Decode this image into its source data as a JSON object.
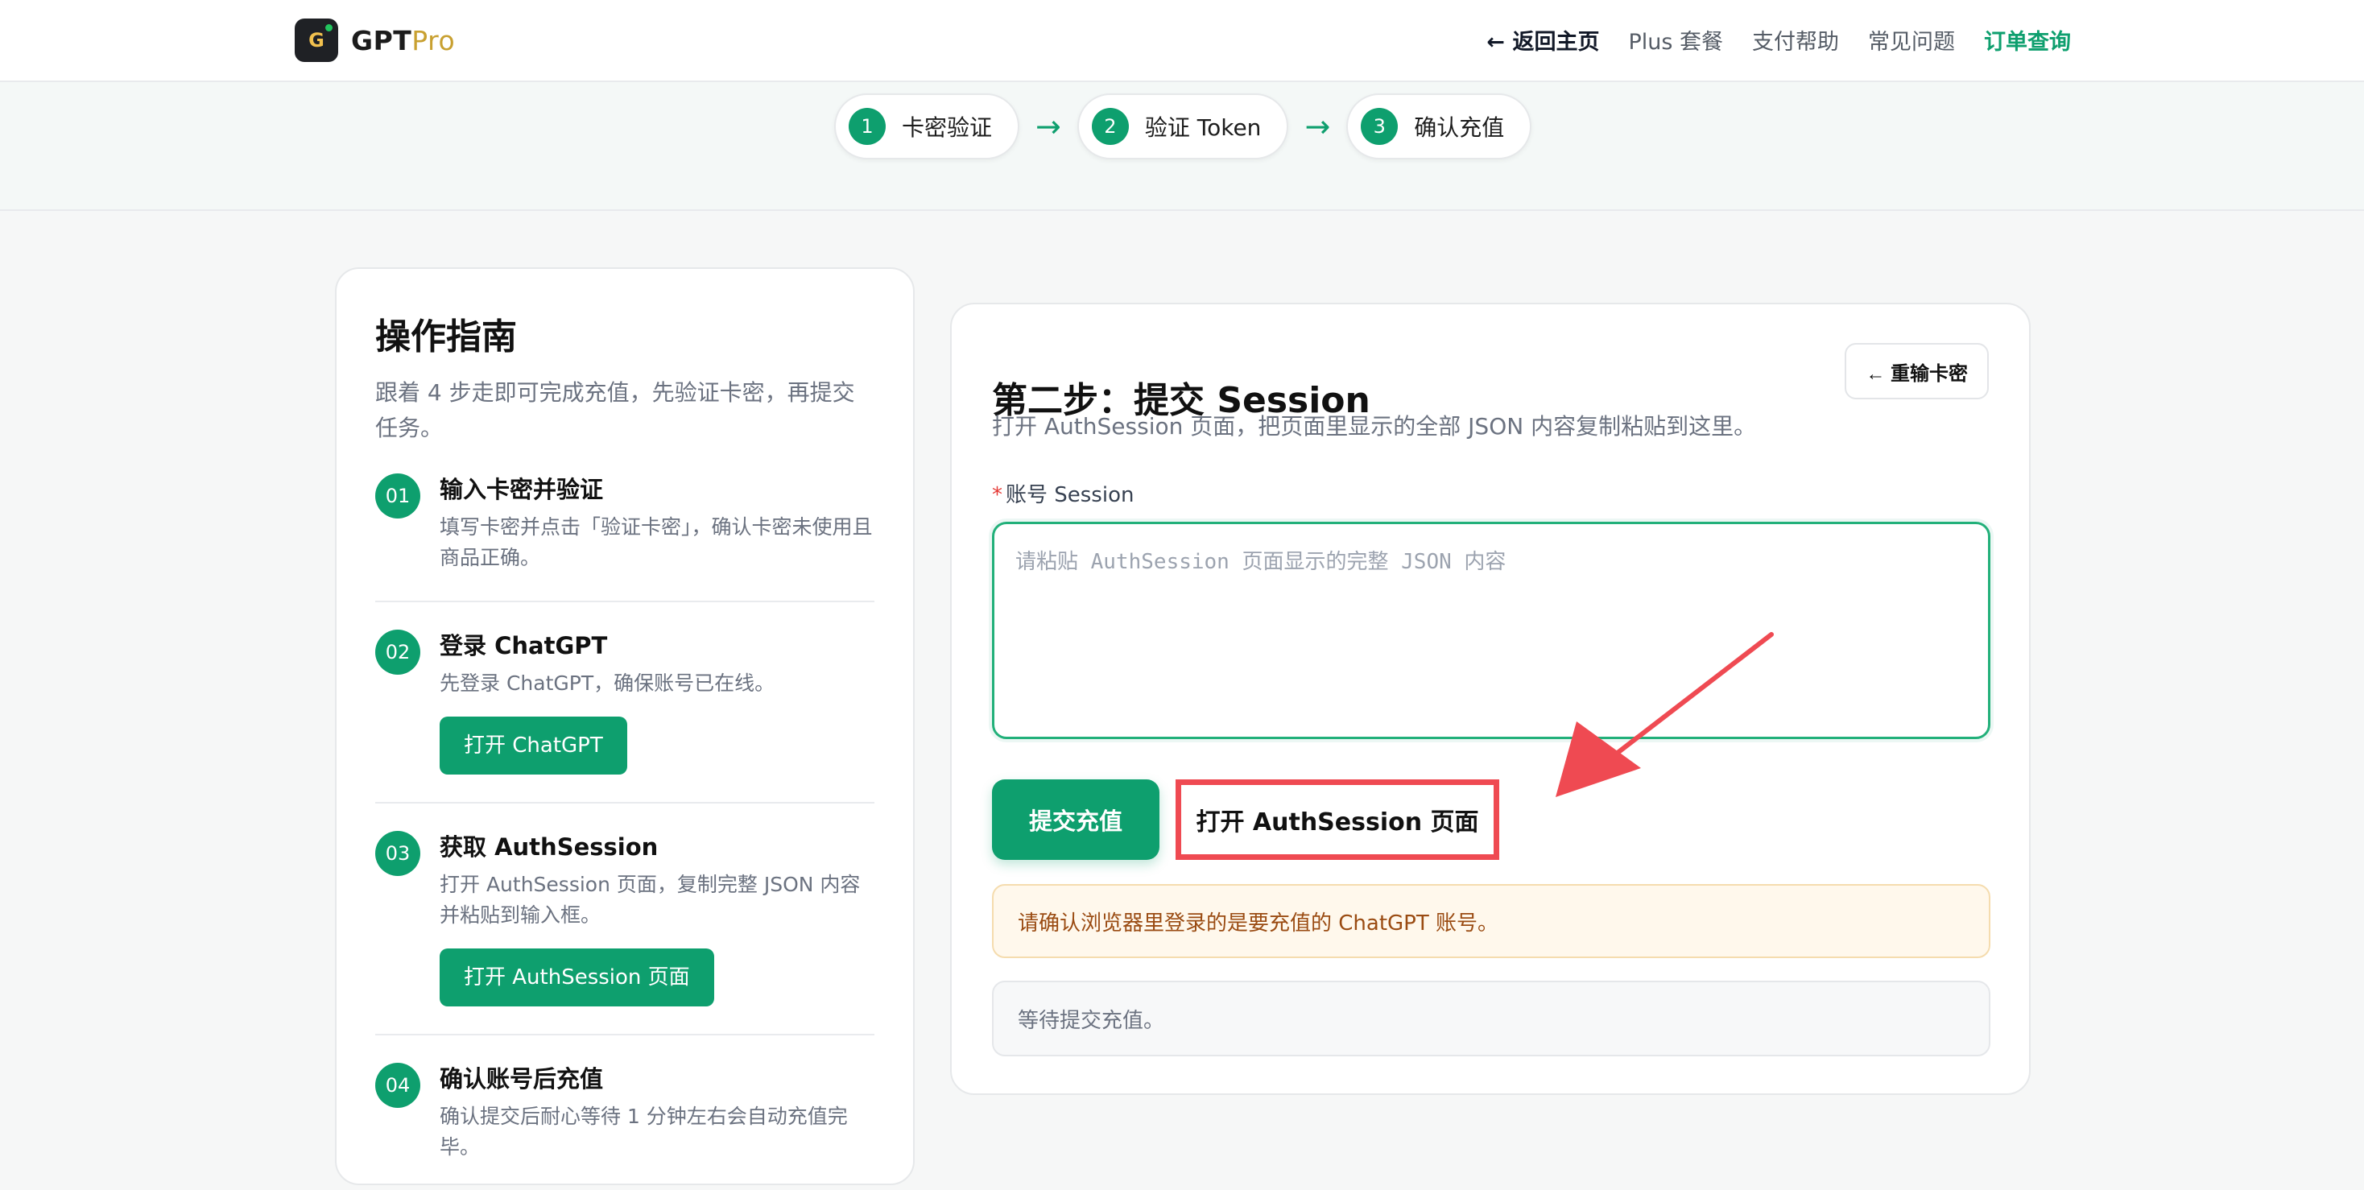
{
  "brand": {
    "logo_letter": "G",
    "name_main": "GPT",
    "name_accent": "Pro"
  },
  "nav": {
    "back_home": "← 返回主页",
    "plus_plans": "Plus 套餐",
    "payment_help": "支付帮助",
    "faq": "常见问题",
    "order_lookup": "订单查询"
  },
  "stepper": [
    {
      "num": "1",
      "label": "卡密验证"
    },
    {
      "num": "2",
      "label": "验证 Token"
    },
    {
      "num": "3",
      "label": "确认充值"
    }
  ],
  "stepper_arrow": "→",
  "guide": {
    "title": "操作指南",
    "subtitle": "跟着 4 步走即可完成充值，先验证卡密，再提交任务。",
    "steps": [
      {
        "num": "01",
        "title": "输入卡密并验证",
        "desc": "填写卡密并点击「验证卡密」，确认卡密未使用且商品正确。"
      },
      {
        "num": "02",
        "title": "登录 ChatGPT",
        "desc": "先登录 ChatGPT，确保账号已在线。",
        "button": "打开 ChatGPT"
      },
      {
        "num": "03",
        "title": "获取 AuthSession",
        "desc": "打开 AuthSession 页面，复制完整 JSON 内容并粘贴到输入框。",
        "button": "打开 AuthSession 页面"
      },
      {
        "num": "04",
        "title": "确认账号后充值",
        "desc": "确认提交后耐心等待 1 分钟左右会自动充值完毕。"
      }
    ]
  },
  "form": {
    "title": "第二步：提交 Session",
    "rekey_button": "← 重输卡密",
    "description": "打开 AuthSession 页面，把页面里显示的全部 JSON 内容复制粘贴到这里。",
    "field_required_mark": "*",
    "field_label": "账号 Session",
    "input_value": "",
    "input_placeholder": "请粘贴 AuthSession 页面显示的完整 JSON 内容",
    "submit_button": "提交充值",
    "open_auth_button": "打开 AuthSession 页面",
    "notice": "请确认浏览器里登录的是要充值的 ChatGPT 账号。",
    "status": "等待提交充值。"
  },
  "colors": {
    "accent_green": "#0e9f6e",
    "highlight_red": "#ef4a52",
    "notice_text": "#9a4b12",
    "brand_gold": "#c8a030"
  },
  "icons": {
    "brand_logo": "app-logo-icon",
    "annotation_arrow": "red-pointer-arrow-icon"
  }
}
